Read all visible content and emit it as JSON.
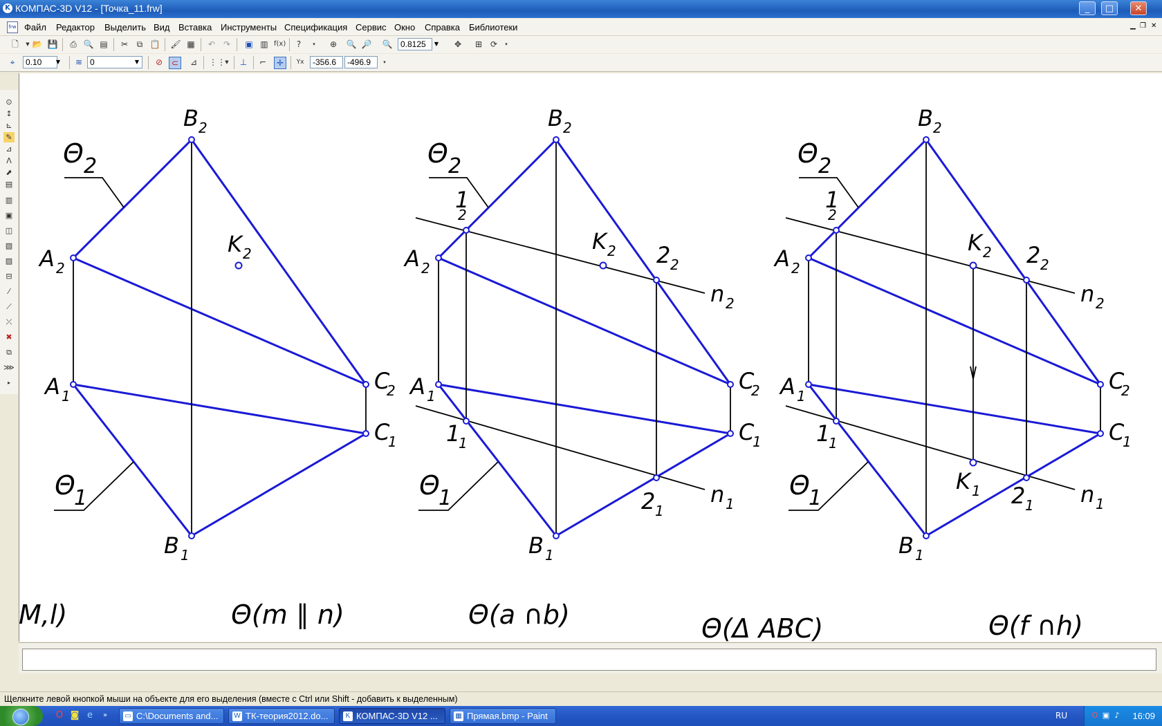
{
  "window": {
    "title": "КОМПАС-3D V12 - [Точка_11.frw]",
    "minimize": "_",
    "maximize": "□",
    "close": "✕"
  },
  "menu": {
    "items": [
      "Файл",
      "Редактор",
      "Выделить",
      "Вид",
      "Вставка",
      "Инструменты",
      "Спецификация",
      "Сервис",
      "Окно",
      "Справка",
      "Библиотеки"
    ]
  },
  "toolbar": {
    "zoom_value": "0.8125",
    "step_value": "0.10",
    "layer_value": "0",
    "coord_x": "-356.6",
    "coord_y": "-496.9"
  },
  "drawing": {
    "colors": {
      "figure": "#1a1ad6",
      "line": "#000000"
    },
    "labels": {
      "theta2": "Θ",
      "theta2_sub": "2",
      "theta1": "Θ",
      "theta1_sub": "1",
      "B2": "B",
      "B2_sub": "2",
      "A2": "A",
      "A2_sub": "2",
      "K2": "K",
      "K2_sub": "2",
      "A1": "A",
      "A1_sub": "1",
      "C2": "C",
      "C2_sub": "2",
      "C1": "C",
      "C1_sub": "1",
      "B1": "B",
      "B1_sub": "1",
      "one2": "1",
      "one2_sub": "2",
      "two2": "2",
      "two2_sub": "2",
      "n2": "n",
      "n2_sub": "2",
      "one1": "1",
      "one1_sub": "1",
      "two1": "2",
      "two1_sub": "1",
      "n1": "n",
      "n1_sub": "1",
      "K1": "K",
      "K1_sub": "1"
    },
    "notations": [
      "M,l)",
      "Θ(m ∥ n)",
      "Θ(a ∩b)",
      "Θ(Δ ABC)",
      "Θ(f ∩h)"
    ]
  },
  "status_text": "Щелкните левой кнопкой мыши на объекте для его выделения (вместе с Ctrl или Shift - добавить к выделенным)",
  "taskbar": {
    "tasks": [
      "C:\\Documents and...",
      "ТК-теория2012.do...",
      "КОМПАС-3D V12 ...",
      "Прямая.bmp - Paint"
    ],
    "language": "RU",
    "clock": "16:09"
  }
}
